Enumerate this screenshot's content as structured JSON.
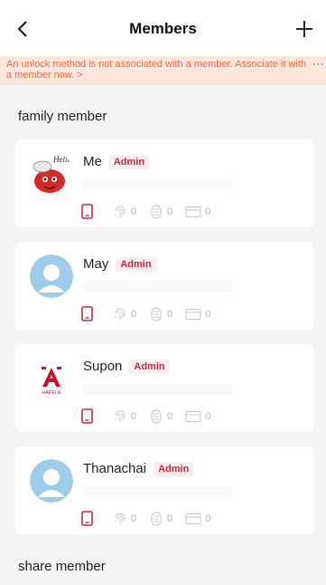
{
  "header": {
    "title": "Members",
    "back_icon": "chevron-left-icon",
    "add_icon": "plus-icon"
  },
  "notice": {
    "text": "An unlock method is not associated with a member. Associate it with a member now. >",
    "color": "#ea6b44"
  },
  "sections": {
    "family": "family member",
    "share": "share member"
  },
  "members": [
    {
      "name": "Me",
      "role": "Admin",
      "avatar": "cartoon-avatar",
      "fingerprint": "0",
      "password": "0",
      "card": "0"
    },
    {
      "name": "May",
      "role": "Admin",
      "avatar": "default-avatar",
      "fingerprint": "0",
      "password": "0",
      "card": "0"
    },
    {
      "name": "Supon",
      "role": "Admin",
      "avatar": "hafele-logo-avatar",
      "fingerprint": "0",
      "password": "0",
      "card": "0"
    },
    {
      "name": "Thanachai",
      "role": "Admin",
      "avatar": "default-avatar",
      "fingerprint": "0",
      "password": "0",
      "card": "0"
    }
  ],
  "avatar_logo_text": "HÄFELE",
  "avatar_cartoon_text": "Hello",
  "colors": {
    "accent": "#c8293e",
    "badge_bg": "#f8ecee",
    "notice_bg": "#fde6dc",
    "avatar_blue": "#9ecde9"
  }
}
